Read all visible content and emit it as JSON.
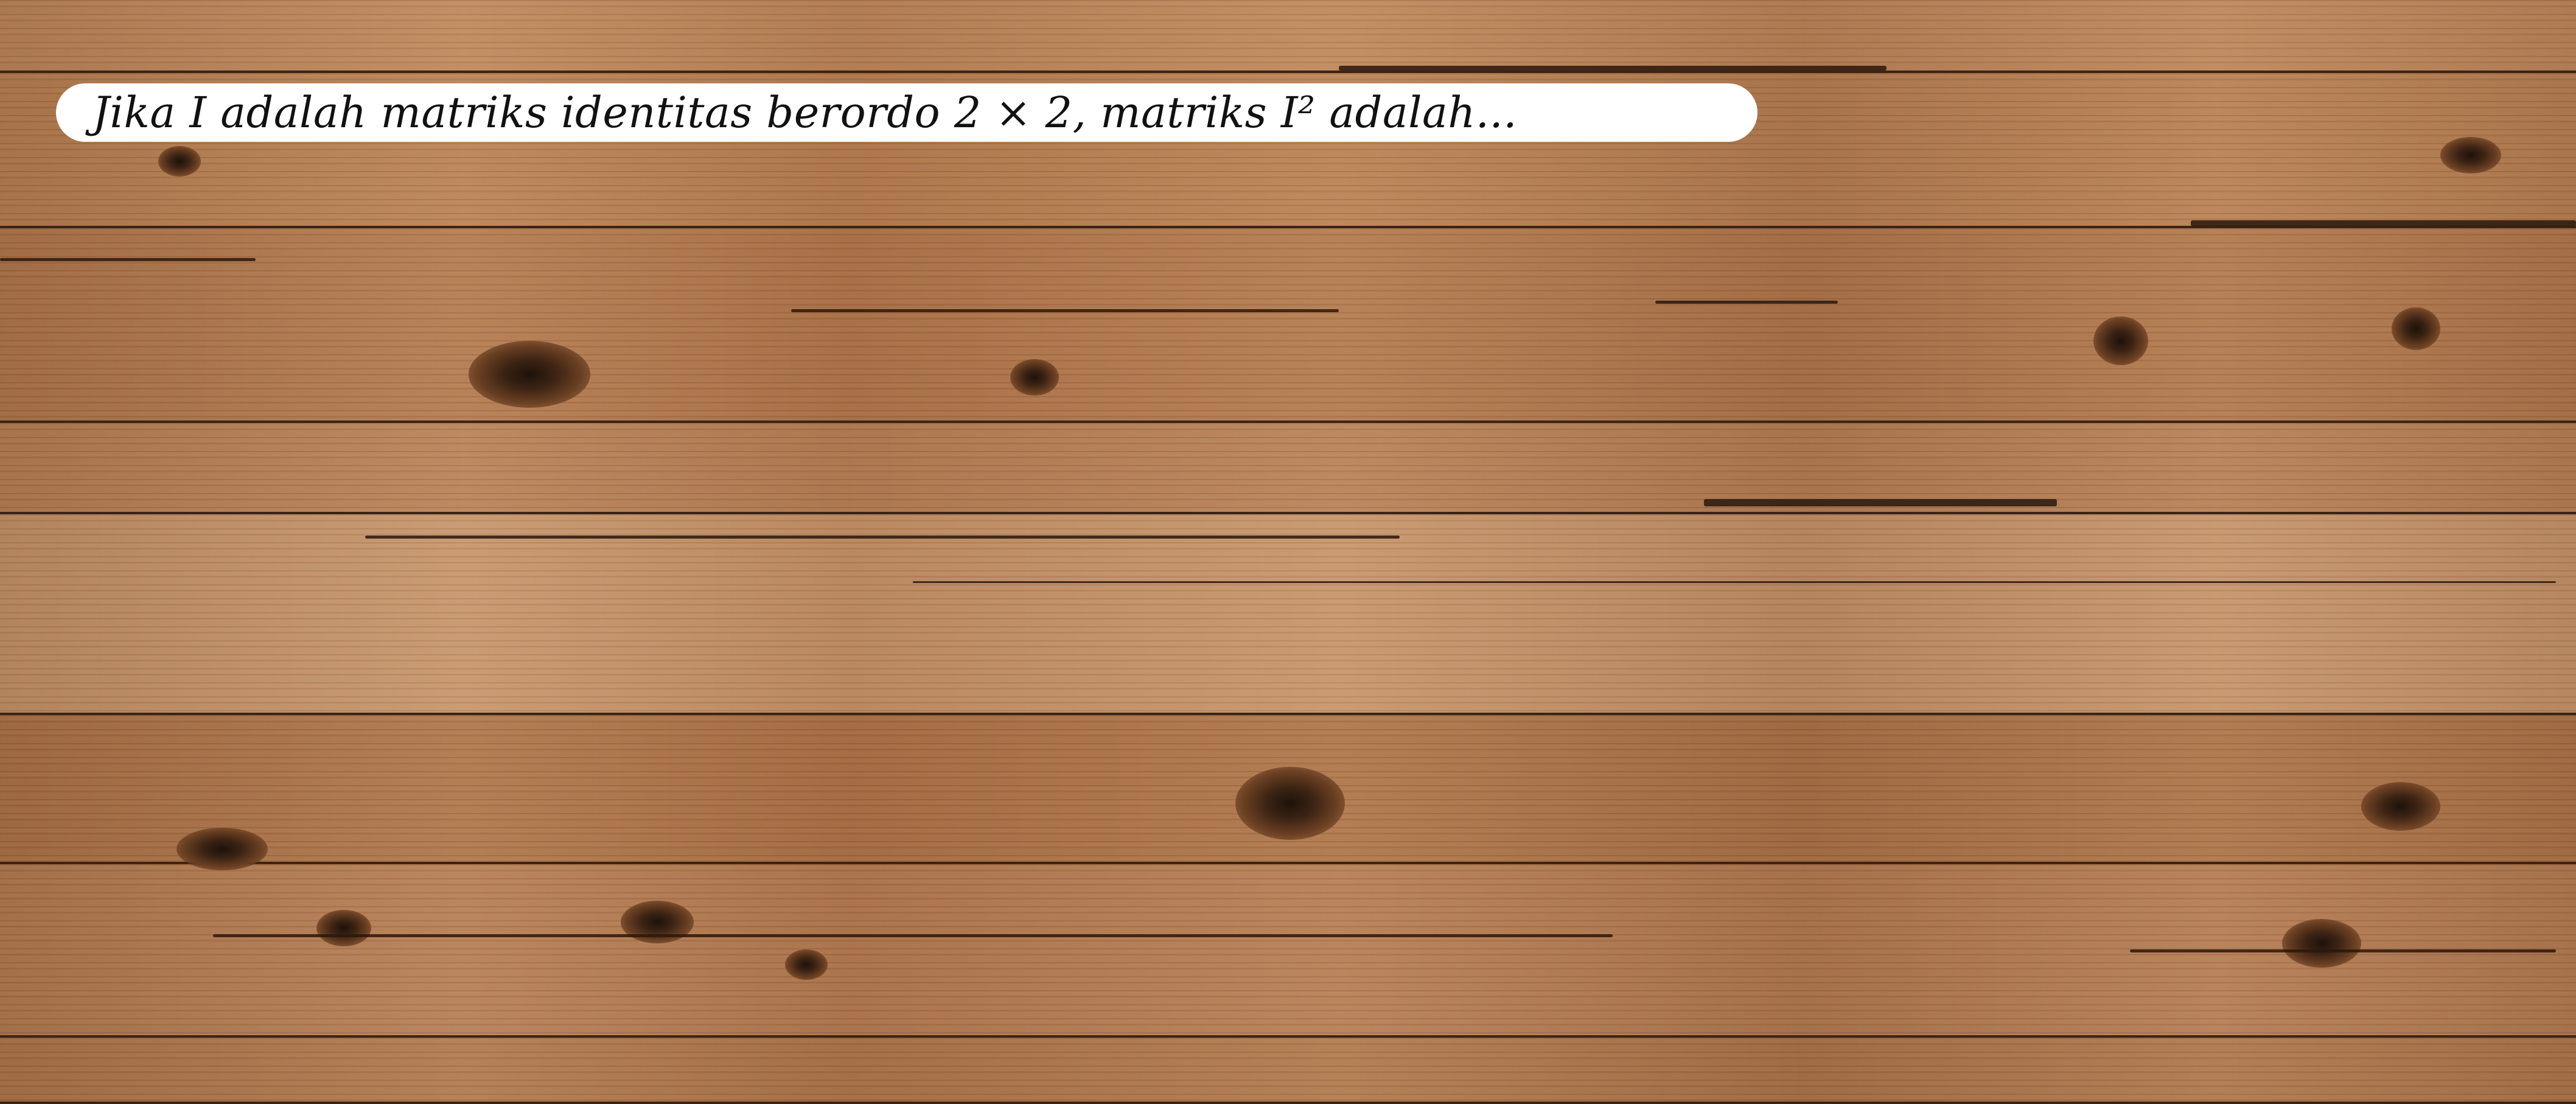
{
  "question": {
    "text": "Jika I adalah matriks identitas berordo 2 × 2, matriks I² adalah..."
  }
}
